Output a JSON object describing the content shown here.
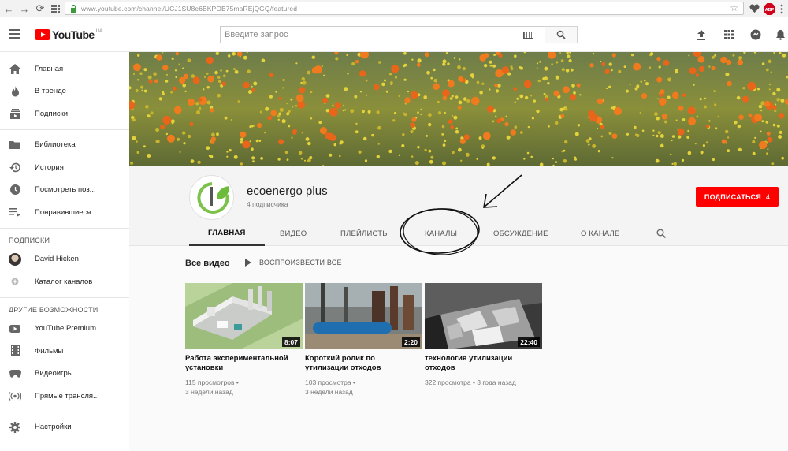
{
  "browser": {
    "url": "www.youtube.com/channel/UCJ1SU8e6BKPOB75maREjQGQ/featured",
    "ext_badge": "ABP"
  },
  "header": {
    "logo_text": "YouTube",
    "logo_region": "UA",
    "search_placeholder": "Введите запрос"
  },
  "sidebar": {
    "main": [
      {
        "label": "Главная",
        "icon": "home-icon"
      },
      {
        "label": "В тренде",
        "icon": "flame-icon"
      },
      {
        "label": "Подписки",
        "icon": "subscriptions-icon"
      }
    ],
    "library": [
      {
        "label": "Библиотека",
        "icon": "folder-icon"
      },
      {
        "label": "История",
        "icon": "history-icon"
      },
      {
        "label": "Посмотреть поз...",
        "icon": "clock-icon"
      },
      {
        "label": "Понравившиеся",
        "icon": "playlist-icon"
      }
    ],
    "subs_heading": "ПОДПИСКИ",
    "subs": [
      {
        "label": "David Hicken"
      },
      {
        "label": "Каталог каналов"
      }
    ],
    "more_heading": "ДРУГИЕ ВОЗМОЖНОСТИ",
    "more": [
      {
        "label": "YouTube Premium",
        "icon": "youtube-icon"
      },
      {
        "label": "Фильмы",
        "icon": "film-icon"
      },
      {
        "label": "Видеоигры",
        "icon": "gamepad-icon"
      },
      {
        "label": "Прямые трансля...",
        "icon": "live-icon"
      }
    ],
    "settings": "Настройки"
  },
  "channel": {
    "name": "ecoenergo plus",
    "subscribers": "4 подписчика",
    "subscribe_label": "ПОДПИСАТЬСЯ",
    "subscribe_count": "4",
    "tabs": [
      "ГЛАВНАЯ",
      "ВИДЕО",
      "ПЛЕЙЛИСТЫ",
      "КАНАЛЫ",
      "ОБСУЖДЕНИЕ",
      "О КАНАЛЕ"
    ],
    "active_tab": "ГЛАВНАЯ"
  },
  "section": {
    "title": "Все видео",
    "play_all": "ВОСПРОИЗВЕСТИ ВСЕ"
  },
  "videos": [
    {
      "title": "Работа экспериментальной установки",
      "duration": "8:07",
      "views": "115 просмотров •",
      "age": "3 недели назад"
    },
    {
      "title": "Короткий ролик по утилизации отходов",
      "duration": "2:20",
      "views": "103 просмотра •",
      "age": "3 недели назад"
    },
    {
      "title": "технология утилизации отходов",
      "duration": "22:40",
      "views": "322 просмотра • 3 года назад",
      "age": ""
    }
  ],
  "colors": {
    "brand_red": "#ff0000",
    "logo_green": "#6dbb3a"
  }
}
